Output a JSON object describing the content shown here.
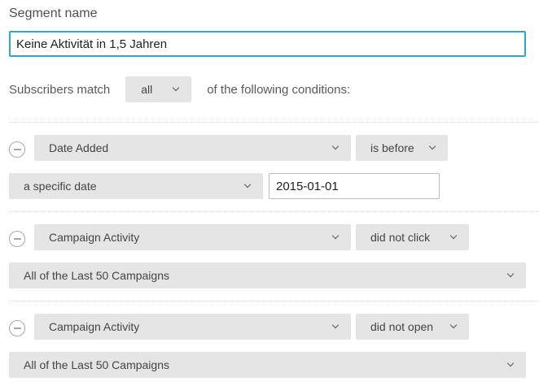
{
  "segment": {
    "title": "Segment name",
    "name_value": "Keine Aktivität in 1,5 Jahren"
  },
  "match": {
    "prefix": "Subscribers match",
    "selected": "all",
    "suffix": "of the following conditions:"
  },
  "conditions": [
    {
      "field": "Date Added",
      "operator": "is before",
      "secondary": "a specific date",
      "date_value": "2015-01-01"
    },
    {
      "field": "Campaign Activity",
      "operator": "did not click",
      "secondary": "All of the Last 50 Campaigns"
    },
    {
      "field": "Campaign Activity",
      "operator": "did not open",
      "secondary": "All of the Last 50 Campaigns"
    }
  ],
  "colors": {
    "input_focus_border": "#2fa6cf",
    "select_background": "#e5e5e5",
    "text": "#4a4a4a"
  },
  "icons": {
    "remove": "remove-condition-icon",
    "dropdown": "chevron-down-icon"
  }
}
